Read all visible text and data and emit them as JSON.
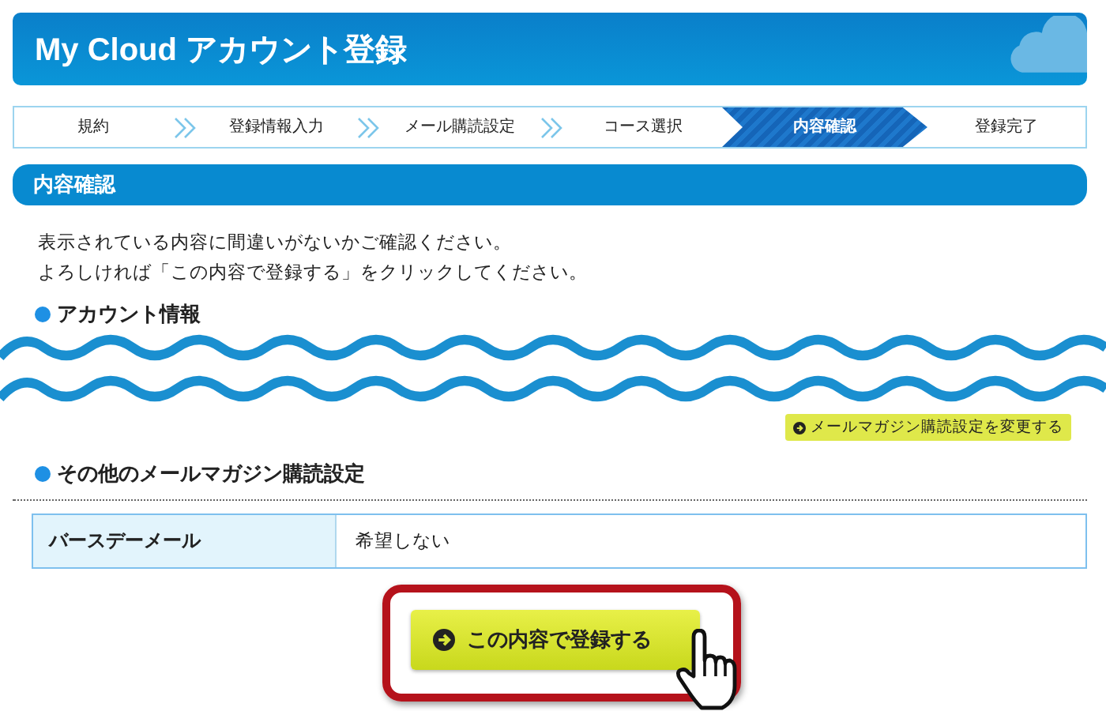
{
  "header": {
    "title": "My Cloud アカウント登録"
  },
  "steps": [
    {
      "label": "規約",
      "selected": false
    },
    {
      "label": "登録情報入力",
      "selected": false
    },
    {
      "label": "メール購読設定",
      "selected": false
    },
    {
      "label": "コース選択",
      "selected": false
    },
    {
      "label": "内容確認",
      "selected": true
    },
    {
      "label": "登録完了",
      "selected": false
    }
  ],
  "section": {
    "title": "内容確認"
  },
  "intro": [
    "表示されている内容に間違いがないかご確認ください。",
    "よろしければ「この内容で登録する」をクリックしてください。"
  ],
  "account": {
    "heading": "アカウント情報",
    "change_button": "メールマガジン購読設定を変更する"
  },
  "newsletter": {
    "heading": "その他のメールマガジン購読設定",
    "rows": [
      {
        "label": "バースデーメール",
        "value": "希望しない"
      }
    ]
  },
  "submit": {
    "label": "この内容で登録する",
    "highlighted": true
  }
}
